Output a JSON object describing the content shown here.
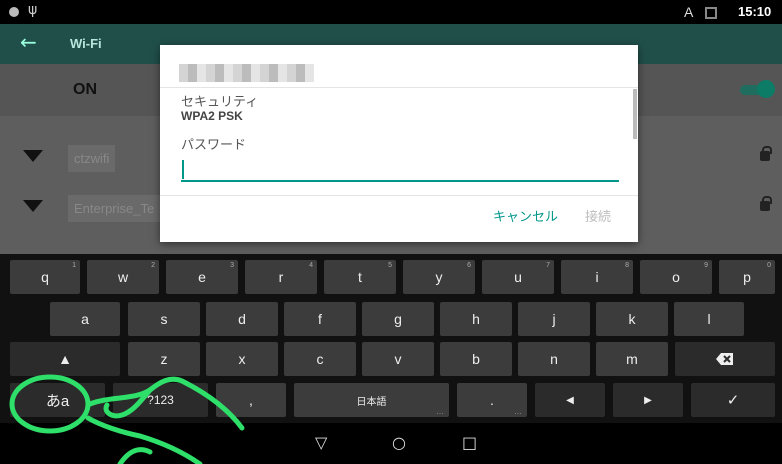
{
  "status": {
    "time": "15:10",
    "usb_icon": "usb-icon",
    "a_indicator": "A"
  },
  "settings": {
    "title": "Wi-Fi",
    "back_icon": "arrow-back-icon",
    "wifi_toggle": "ON",
    "networks": [
      {
        "name": "ctzwifi"
      },
      {
        "name": "Enterprise_Te"
      }
    ]
  },
  "dialog": {
    "security_label": "セキュリティ",
    "security_value": "WPA2 PSK",
    "password_label": "パスワード",
    "password_value": "",
    "cancel_label": "キャンセル",
    "connect_label": "接続"
  },
  "keyboard": {
    "row1": [
      {
        "label": "q",
        "hint": "1"
      },
      {
        "label": "w",
        "hint": "2"
      },
      {
        "label": "e",
        "hint": "3"
      },
      {
        "label": "r",
        "hint": "4"
      },
      {
        "label": "t",
        "hint": "5"
      },
      {
        "label": "y",
        "hint": "6"
      },
      {
        "label": "u",
        "hint": "7"
      },
      {
        "label": "i",
        "hint": "8"
      },
      {
        "label": "o",
        "hint": "9"
      },
      {
        "label": "p",
        "hint": "0"
      }
    ],
    "row2": [
      "a",
      "s",
      "d",
      "f",
      "g",
      "h",
      "j",
      "k",
      "l"
    ],
    "row3": [
      "z",
      "x",
      "c",
      "v",
      "b",
      "n",
      "m"
    ],
    "shift_icon": "shift-icon",
    "backspace_icon": "backspace-icon",
    "lang_key": "あa",
    "symbols_key": "?123",
    "comma_key": ",",
    "space_key": "日本語",
    "period_key": ".",
    "left_icon": "arrow-left-icon",
    "right_icon": "arrow-right-icon",
    "enter_icon": "checkmark-icon"
  },
  "navbar": {
    "back_icon": "back-triangle-icon",
    "home_icon": "home-circle-icon",
    "recents_icon": "recents-square-icon"
  },
  "colors": {
    "accent": "#00968a",
    "annotation": "#2ee06a"
  }
}
